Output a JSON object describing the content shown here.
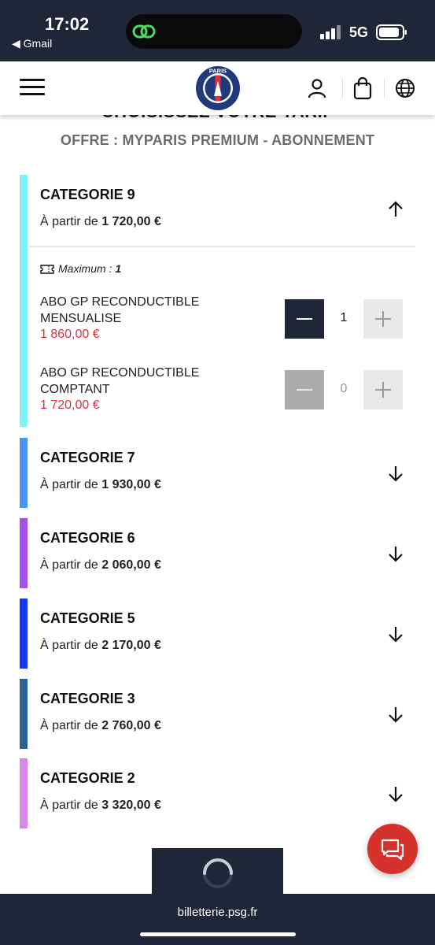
{
  "status_bar": {
    "time": "17:02",
    "back_app": "◀ Gmail",
    "network": "5G",
    "icons": [
      "signal-icon",
      "battery-icon",
      "link-icon"
    ]
  },
  "header": {
    "icons": [
      "menu-icon",
      "psg-logo",
      "user-icon",
      "bag-icon",
      "globe-icon"
    ],
    "logo_text": "PARIS"
  },
  "page": {
    "title": "CHOISISSEZ VOTRE TARIF",
    "offer": "OFFRE : MYPARIS PREMIUM - ABONNEMENT"
  },
  "categories": [
    {
      "name": "CATEGORIE 9",
      "price_prefix": "À partir de ",
      "price": "1 720,00 €",
      "color": "#7ef2f6",
      "expanded": true,
      "max_label": "Maximum : ",
      "max_value": "1",
      "products": [
        {
          "name": "ABO GP RECONDUCTIBLE MENSUALISE",
          "price": "1 860,00 €",
          "quantity": "1"
        },
        {
          "name": "ABO GP RECONDUCTIBLE COMPTANT",
          "price": "1 720,00 €",
          "quantity": "0"
        }
      ]
    },
    {
      "name": "CATEGORIE 7",
      "price_prefix": "À partir de ",
      "price": "1 930,00 €",
      "color": "#4a95f3",
      "expanded": false
    },
    {
      "name": "CATEGORIE 6",
      "price_prefix": "À partir de ",
      "price": "2 060,00 €",
      "color": "#a550e6",
      "expanded": false
    },
    {
      "name": "CATEGORIE 5",
      "price_prefix": "À partir de ",
      "price": "2 170,00 €",
      "color": "#1638f0",
      "expanded": false
    },
    {
      "name": "CATEGORIE 3",
      "price_prefix": "À partir de ",
      "price": "2 760,00 €",
      "color": "#2d6190",
      "expanded": false
    },
    {
      "name": "CATEGORIE 2",
      "price_prefix": "À partir de ",
      "price": "3 320,00 €",
      "color": "#d889e8",
      "expanded": false
    }
  ],
  "colors": {
    "navy": "#1e2638",
    "price_red": "#d8323f",
    "chat_red": "#d5312d"
  },
  "browser": {
    "url": "billetterie.psg.fr"
  }
}
